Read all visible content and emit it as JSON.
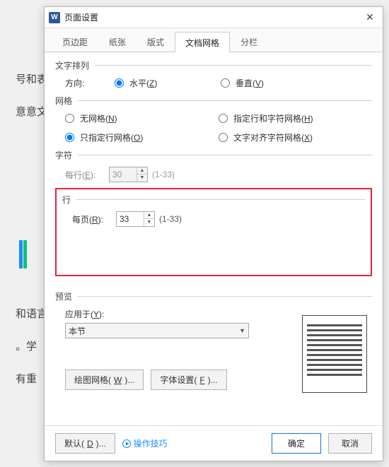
{
  "titlebar": {
    "icon_letter": "W",
    "title": "页面设置"
  },
  "tabs": [
    "页边距",
    "纸张",
    "版式",
    "文档网格",
    "分栏"
  ],
  "active_tab": 3,
  "text_arrange": {
    "group": "文字排列",
    "direction_label": "方向:",
    "horizontal": "水平(Z)",
    "vertical": "垂直(V)",
    "selected": "horizontal"
  },
  "grid": {
    "group": "网格",
    "none": "无网格(N)",
    "row_char": "指定行和字符网格(H)",
    "row_only": "只指定行网格(O)",
    "char_align": "文字对齐字符网格(X)",
    "selected": "row_only"
  },
  "chars": {
    "group": "字符",
    "per_line_label": "每行(E):",
    "per_line_value": "30",
    "per_line_range": "(1-33)"
  },
  "lines": {
    "group": "行",
    "per_page_label": "每页(R):",
    "per_page_value": "33",
    "per_page_range": "(1-33)"
  },
  "preview": {
    "group": "预览",
    "apply_label": "应用于(Y):",
    "apply_value": "本节"
  },
  "buttons": {
    "draw_grid": "绘图网格(W)...",
    "font_set": "字体设置(F)...",
    "defaults": "默认(D)...",
    "tips": "操作技巧",
    "ok": "确定",
    "cancel": "取消"
  },
  "bg": {
    "l1": "号和表",
    "l2": "意意文",
    "l3": "和语言",
    "l4": "。学",
    "l5": "有重"
  }
}
